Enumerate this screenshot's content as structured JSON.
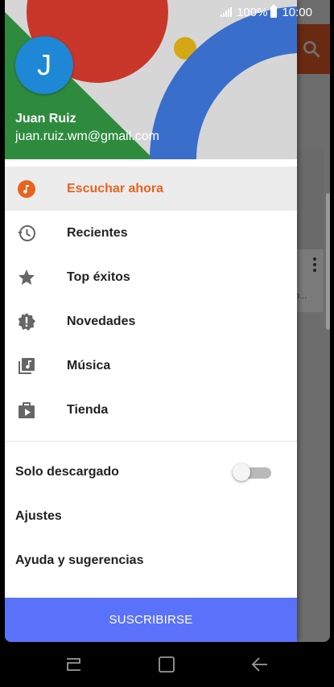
{
  "status": {
    "signal": "signal-icon",
    "battery_pct": "100%",
    "time": "10:00"
  },
  "account": {
    "initial": "J",
    "name": "Juan Ruiz",
    "email": "juan.ruiz.wm@gmail.com"
  },
  "menu": {
    "items": [
      {
        "label": "Escuchar ahora",
        "icon": "music-note-icon",
        "active": true
      },
      {
        "label": "Recientes",
        "icon": "history-icon"
      },
      {
        "label": "Top éxitos",
        "icon": "star-icon"
      },
      {
        "label": "Novedades",
        "icon": "new-badge-icon"
      },
      {
        "label": "Música",
        "icon": "library-music-icon"
      },
      {
        "label": "Tienda",
        "icon": "play-store-icon"
      }
    ]
  },
  "settings": {
    "downloaded_only": {
      "label": "Solo descargado",
      "on": false
    },
    "settings_label": "Ajustes",
    "help_label": "Ayuda y sugerencias"
  },
  "subscribe_label": "SUSCRIBIRSE",
  "background": {
    "card_text": "o..."
  },
  "colors": {
    "accent": "#e8631f",
    "subscribe": "#5a72fa",
    "avatar": "#1e88d6"
  }
}
